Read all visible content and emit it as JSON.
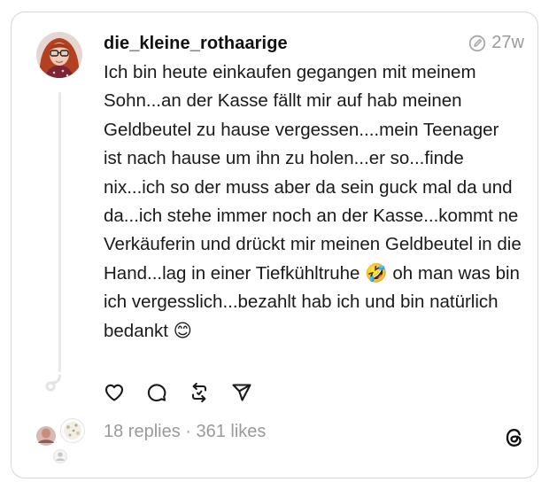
{
  "post": {
    "username": "die_kleine_rothaarige",
    "timestamp": "27w",
    "text": "Ich bin heute einkaufen gegangen mit meinem Sohn...an der Kasse fällt mir auf hab meinen Geldbeutel zu hause vergessen....mein Teenager ist nach hause um ihn zu holen...er so...finde nix...ich so der muss aber da sein guck mal da und da...ich stehe immer noch an der Kasse...kommt ne Verkäuferin und drückt mir meinen Geldbeutel in die Hand...lag in einer Tiefkühltruhe 🤣 oh man was bin ich vergesslich...bezahlt hab ich und bin natürlich bedankt 😊"
  },
  "stats": {
    "text": "18 replies · 361 likes"
  },
  "icons": {
    "edited": "edited-icon",
    "like": "heart-icon",
    "reply": "comment-icon",
    "repost": "repost-icon",
    "share": "send-icon",
    "logo": "threads-logo-icon"
  },
  "colors": {
    "text": "#1a1a1a",
    "muted": "#9a9a9a",
    "border": "#d6d6d6"
  }
}
